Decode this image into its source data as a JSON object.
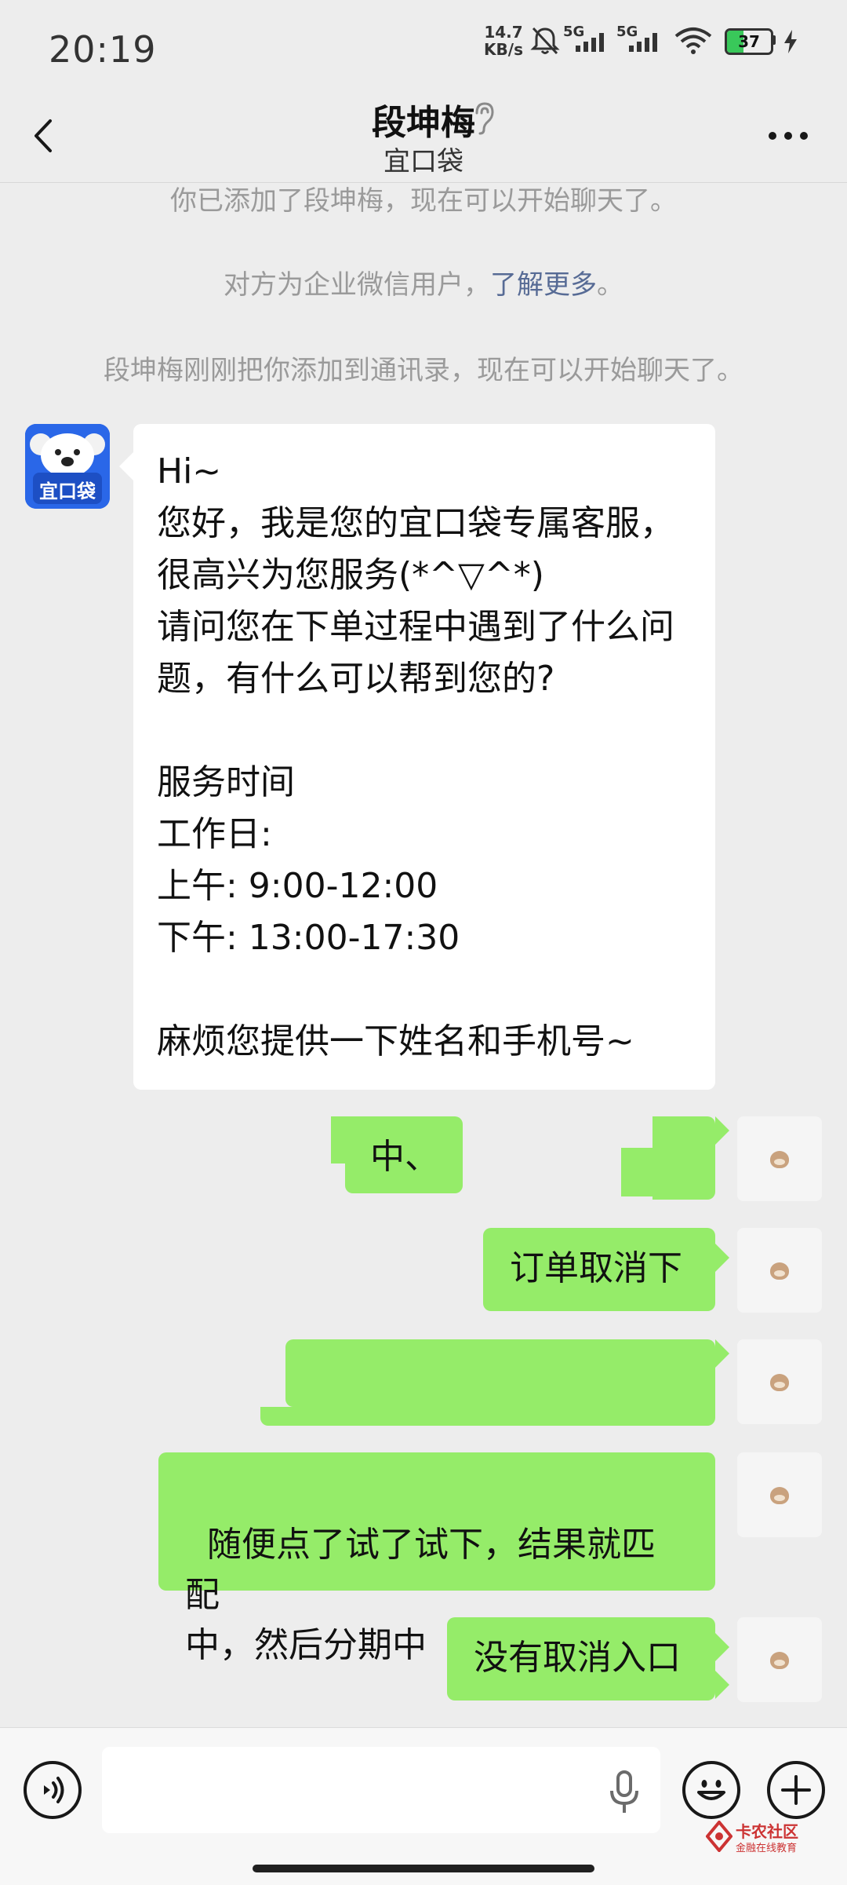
{
  "status_bar": {
    "time": "20:19",
    "net_speed_value": "14.7",
    "net_speed_unit": "KB/s",
    "signal1_label": "5G",
    "signal2_label": "5G",
    "battery_percent": 37,
    "battery_text": "37",
    "battery_color": "#39c85a"
  },
  "header": {
    "title": "段坤梅",
    "subtitle": "宜口袋",
    "back_icon": "chevron-left-icon",
    "more_icon": "more-dots-icon"
  },
  "system_messages": {
    "added": "你已添加了段坤梅，现在可以开始聊天了。",
    "enterprise_prefix": "对方为企业微信用户，",
    "enterprise_link": "了解更多",
    "enterprise_suffix": "。",
    "contact_added": "段坤梅刚刚把你添加到通讯录，现在可以开始聊天了。"
  },
  "bot": {
    "avatar_label": "宜口袋",
    "message": "Hi~\n您好，我是您的宜口袋专属客服，\n很高兴为您服务(*^▽^*)\n请问您在下单过程中遇到了什么问\n题，有什么可以帮到您的?\n\n服务时间\n工作日:\n上午: 9:00-12:00\n下午: 13:00-17:30\n\n麻烦您提供一下姓名和手机号~"
  },
  "my_messages": [
    {
      "text": "中、"
    },
    {
      "text": "订单取消下"
    },
    {
      "text": ""
    },
    {
      "text": "随便点了试了试下，结果就匹配\n中，然后分期中"
    },
    {
      "text": "没有取消入口"
    }
  ],
  "input_bar": {
    "placeholder": "",
    "voice_icon": "voice-icon",
    "mic_icon": "microphone-icon",
    "emoji_icon": "emoji-icon",
    "plus_icon": "plus-icon"
  },
  "watermark": {
    "line1": "卡农社区",
    "line2": "金融在线教育"
  },
  "colors": {
    "background": "#ededed",
    "out_bubble": "#95ec69",
    "in_bubble": "#ffffff",
    "link": "#576b95"
  }
}
